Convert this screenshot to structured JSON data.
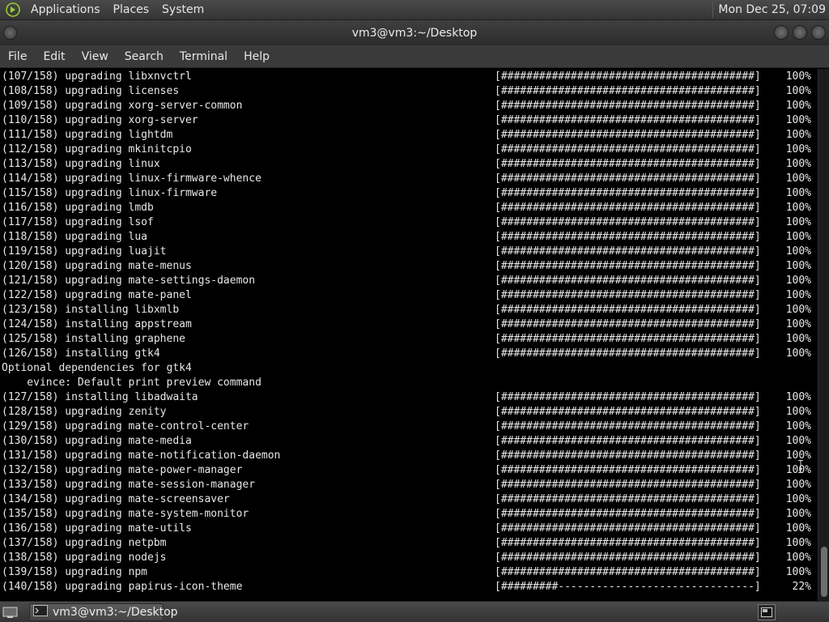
{
  "top_panel": {
    "menus": [
      "Applications",
      "Places",
      "System"
    ],
    "clock": "Mon Dec 25, 07:09"
  },
  "window": {
    "title": "vm3@vm3:~/Desktop"
  },
  "menubar": {
    "items": [
      "File",
      "Edit",
      "View",
      "Search",
      "Terminal",
      "Help"
    ]
  },
  "terminal": {
    "lines": [
      {
        "text": "(107/158) upgrading libxnvctrl",
        "bar": "[########################################]",
        "pct": "100%"
      },
      {
        "text": "(108/158) upgrading licenses",
        "bar": "[########################################]",
        "pct": "100%"
      },
      {
        "text": "(109/158) upgrading xorg-server-common",
        "bar": "[########################################]",
        "pct": "100%"
      },
      {
        "text": "(110/158) upgrading xorg-server",
        "bar": "[########################################]",
        "pct": "100%"
      },
      {
        "text": "(111/158) upgrading lightdm",
        "bar": "[########################################]",
        "pct": "100%"
      },
      {
        "text": "(112/158) upgrading mkinitcpio",
        "bar": "[########################################]",
        "pct": "100%"
      },
      {
        "text": "(113/158) upgrading linux",
        "bar": "[########################################]",
        "pct": "100%"
      },
      {
        "text": "(114/158) upgrading linux-firmware-whence",
        "bar": "[########################################]",
        "pct": "100%"
      },
      {
        "text": "(115/158) upgrading linux-firmware",
        "bar": "[########################################]",
        "pct": "100%"
      },
      {
        "text": "(116/158) upgrading lmdb",
        "bar": "[########################################]",
        "pct": "100%"
      },
      {
        "text": "(117/158) upgrading lsof",
        "bar": "[########################################]",
        "pct": "100%"
      },
      {
        "text": "(118/158) upgrading lua",
        "bar": "[########################################]",
        "pct": "100%"
      },
      {
        "text": "(119/158) upgrading luajit",
        "bar": "[########################################]",
        "pct": "100%"
      },
      {
        "text": "(120/158) upgrading mate-menus",
        "bar": "[########################################]",
        "pct": "100%"
      },
      {
        "text": "(121/158) upgrading mate-settings-daemon",
        "bar": "[########################################]",
        "pct": "100%"
      },
      {
        "text": "(122/158) upgrading mate-panel",
        "bar": "[########################################]",
        "pct": "100%"
      },
      {
        "text": "(123/158) installing libxmlb",
        "bar": "[########################################]",
        "pct": "100%"
      },
      {
        "text": "(124/158) installing appstream",
        "bar": "[########################################]",
        "pct": "100%"
      },
      {
        "text": "(125/158) installing graphene",
        "bar": "[########################################]",
        "pct": "100%"
      },
      {
        "text": "(126/158) installing gtk4",
        "bar": "[########################################]",
        "pct": "100%"
      },
      {
        "text": "Optional dependencies for gtk4",
        "bar": "",
        "pct": ""
      },
      {
        "text": "    evince: Default print preview command",
        "bar": "",
        "pct": ""
      },
      {
        "text": "(127/158) installing libadwaita",
        "bar": "[########################################]",
        "pct": "100%"
      },
      {
        "text": "(128/158) upgrading zenity",
        "bar": "[########################################]",
        "pct": "100%"
      },
      {
        "text": "(129/158) upgrading mate-control-center",
        "bar": "[########################################]",
        "pct": "100%"
      },
      {
        "text": "(130/158) upgrading mate-media",
        "bar": "[########################################]",
        "pct": "100%"
      },
      {
        "text": "(131/158) upgrading mate-notification-daemon",
        "bar": "[########################################]",
        "pct": "100%"
      },
      {
        "text": "(132/158) upgrading mate-power-manager",
        "bar": "[########################################]",
        "pct": "100%"
      },
      {
        "text": "(133/158) upgrading mate-session-manager",
        "bar": "[########################################]",
        "pct": "100%"
      },
      {
        "text": "(134/158) upgrading mate-screensaver",
        "bar": "[########################################]",
        "pct": "100%"
      },
      {
        "text": "(135/158) upgrading mate-system-monitor",
        "bar": "[########################################]",
        "pct": "100%"
      },
      {
        "text": "(136/158) upgrading mate-utils",
        "bar": "[########################################]",
        "pct": "100%"
      },
      {
        "text": "(137/158) upgrading netpbm",
        "bar": "[########################################]",
        "pct": "100%"
      },
      {
        "text": "(138/158) upgrading nodejs",
        "bar": "[########################################]",
        "pct": "100%"
      },
      {
        "text": "(139/158) upgrading npm",
        "bar": "[########################################]",
        "pct": "100%"
      },
      {
        "text": "(140/158) upgrading papirus-icon-theme",
        "bar": "[#########-------------------------------]",
        "pct": "22%"
      }
    ]
  },
  "taskbar": {
    "window_label": "vm3@vm3:~/Desktop"
  },
  "icons": {
    "menu_logo": "mate-logo-icon",
    "show_desktop": "show-desktop-icon",
    "taskbar_terminal": "terminal-icon",
    "workspace": "workspace-switcher-icon"
  }
}
